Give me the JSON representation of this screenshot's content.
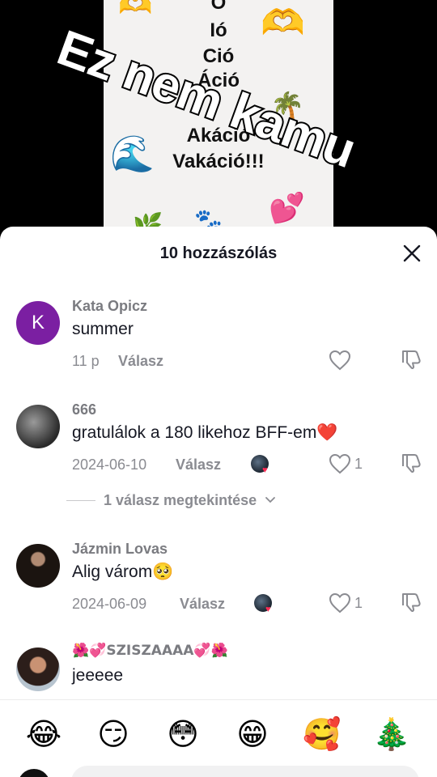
{
  "video": {
    "lines": [
      "Ó",
      "Ió",
      "Ció",
      "Áció",
      "Akáció",
      "Vakáció!!!"
    ],
    "overlay_text": "Ez nem kamu",
    "stickers": [
      "🫶",
      "🫶",
      "🌊",
      "🌴",
      "💕",
      "🌿",
      "🐾"
    ]
  },
  "sheet": {
    "title": "10 hozzászólás",
    "close_icon": "close-icon"
  },
  "comments": [
    {
      "username": "Kata Opicz",
      "avatar_letter": "K",
      "text": "summer",
      "time": "11 p",
      "reply_label": "Válasz",
      "likes": ""
    },
    {
      "username": "666",
      "text": "gratulálok a 180 likehoz BFF-em❤️",
      "time": "2024-06-10",
      "reply_label": "Válasz",
      "likes": "1"
    },
    {
      "username": "Jázmin Lovas",
      "text": "Alig várom🥺",
      "time": "2024-06-09",
      "reply_label": "Válasz",
      "likes": "1"
    },
    {
      "username": "🌺💞SZISZAAAA💞🌺",
      "text": "jeeeee",
      "time": "",
      "reply_label": "",
      "likes": ""
    }
  ],
  "view_replies": "1 válasz megtekintése",
  "emoji_bar": [
    "😂",
    "😏",
    "😳",
    "😁",
    "🥰",
    "🎄"
  ],
  "colors": {
    "avatar_k": "#7b1fa2",
    "heart_accent": "#fe2c55",
    "muted_text": "#8a8b91",
    "primary_text": "#161823"
  }
}
